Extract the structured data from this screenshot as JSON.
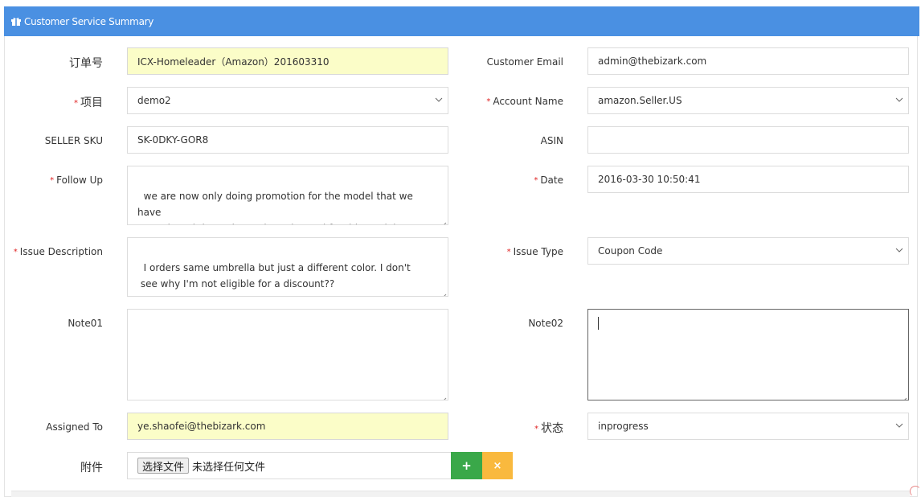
{
  "panel": {
    "title": "Customer Service Summary",
    "icon": "gift-icon",
    "header_color": "#4a90e2"
  },
  "form": {
    "order_no": {
      "label": "订单号",
      "value": "ICX-Homeleader（Amazon）201603310"
    },
    "customer_email": {
      "label": "Customer Email",
      "value": "admin@thebizark.com"
    },
    "project": {
      "label": "项目",
      "value": "demo2",
      "required": true
    },
    "account_name": {
      "label": "Account Name",
      "value": "amazon.Seller.US",
      "required": true
    },
    "seller_sku": {
      "label": "SELLER SKU",
      "value": "SK-0DKY-GOR8"
    },
    "asin": {
      "label": "ASIN",
      "value": ""
    },
    "follow_up": {
      "label": "Follow Up",
      "value": "we are now only doing promotion for the model that we have\nposted. And the code can be only used for this model.",
      "required": true
    },
    "date": {
      "label": "Date",
      "value": "2016-03-30 10:50:41",
      "required": true
    },
    "issue_description": {
      "label": "Issue Description",
      "value": "I orders same umbrella but just a different color. I don't\n see why I'm not eligible for a discount??",
      "required": true
    },
    "issue_type": {
      "label": "Issue Type",
      "value": "Coupon Code",
      "required": true
    },
    "note01": {
      "label": "Note01",
      "value": ""
    },
    "note02": {
      "label": "Note02",
      "value": ""
    },
    "assigned_to": {
      "label": "Assigned To",
      "value": "ye.shaofei@thebizark.com"
    },
    "status": {
      "label": "状态",
      "value": "inprogress",
      "required": true
    },
    "attachment": {
      "label": "附件",
      "button": "选择文件",
      "text": "未选择任何文件"
    }
  },
  "buttons": {
    "add": "+",
    "remove": "×"
  },
  "colors": {
    "required": "#e02222",
    "highlight": "#fbfdc8",
    "add": "#3aa849",
    "remove": "#f9b93e"
  }
}
